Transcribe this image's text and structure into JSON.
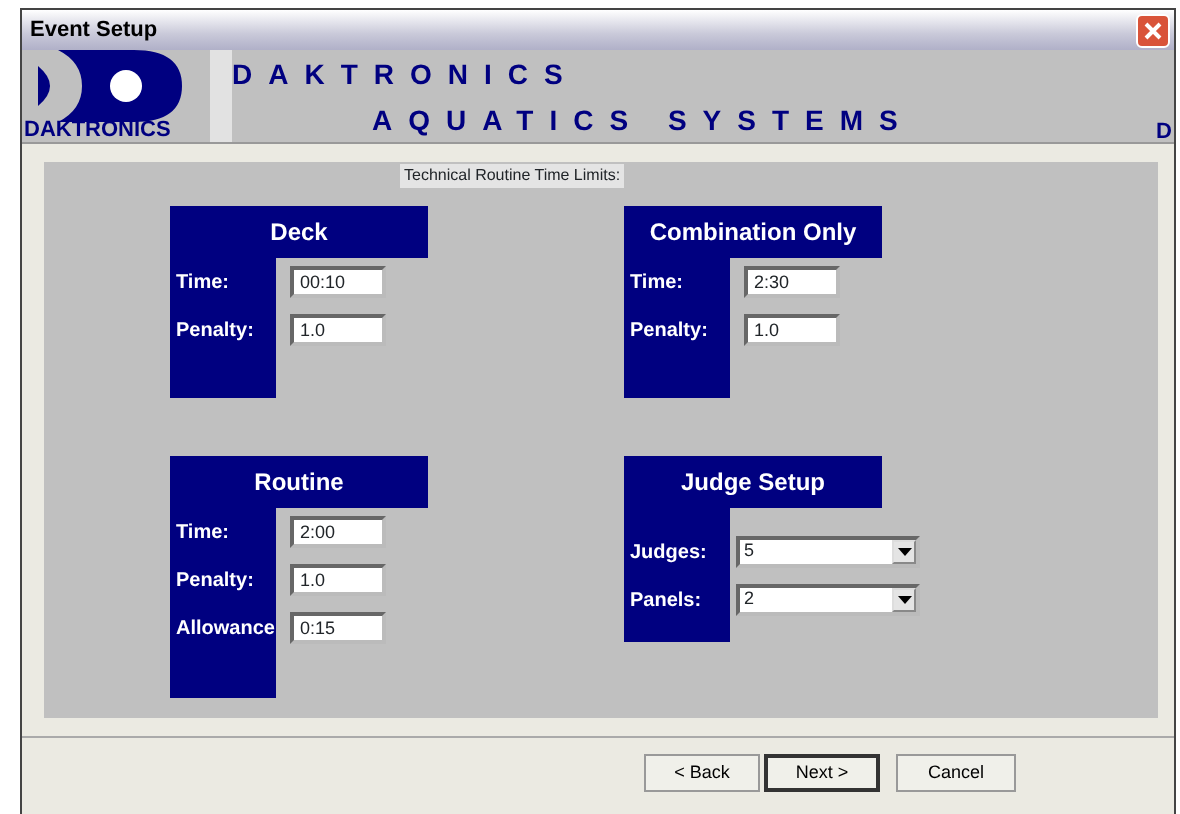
{
  "window": {
    "title": "Event Setup"
  },
  "banner": {
    "logo_caption": "DAKTRONICS",
    "line_1": "DAKTRONICS",
    "line_2": "AQUATICS SYSTEMS",
    "edge_text": "D"
  },
  "caption": "Technical Routine Time Limits:",
  "groups": [
    {
      "title": "Deck",
      "fields": [
        {
          "label": "Time:",
          "kind": "text",
          "value": "00:10"
        },
        {
          "label": "Penalty:",
          "kind": "text",
          "value": "1.0"
        }
      ]
    },
    {
      "title": "Combination Only",
      "fields": [
        {
          "label": "Time:",
          "kind": "text",
          "value": "2:30"
        },
        {
          "label": "Penalty:",
          "kind": "text",
          "value": "1.0"
        }
      ]
    },
    {
      "title": "Routine",
      "fields": [
        {
          "label": "Time:",
          "kind": "text",
          "value": "2:00"
        },
        {
          "label": "Penalty:",
          "kind": "text",
          "value": "1.0"
        },
        {
          "label": "Allowance",
          "kind": "text",
          "value": "0:15"
        }
      ]
    },
    {
      "title": "Judge Setup",
      "fields": [
        {
          "label": "Judges:",
          "kind": "select",
          "value": "5"
        },
        {
          "label": "Panels:",
          "kind": "select",
          "value": "2"
        }
      ]
    }
  ],
  "buttons": [
    {
      "label": "< Back",
      "default": false
    },
    {
      "label": "Next >",
      "default": true
    },
    {
      "label": "Cancel",
      "default": false
    }
  ]
}
